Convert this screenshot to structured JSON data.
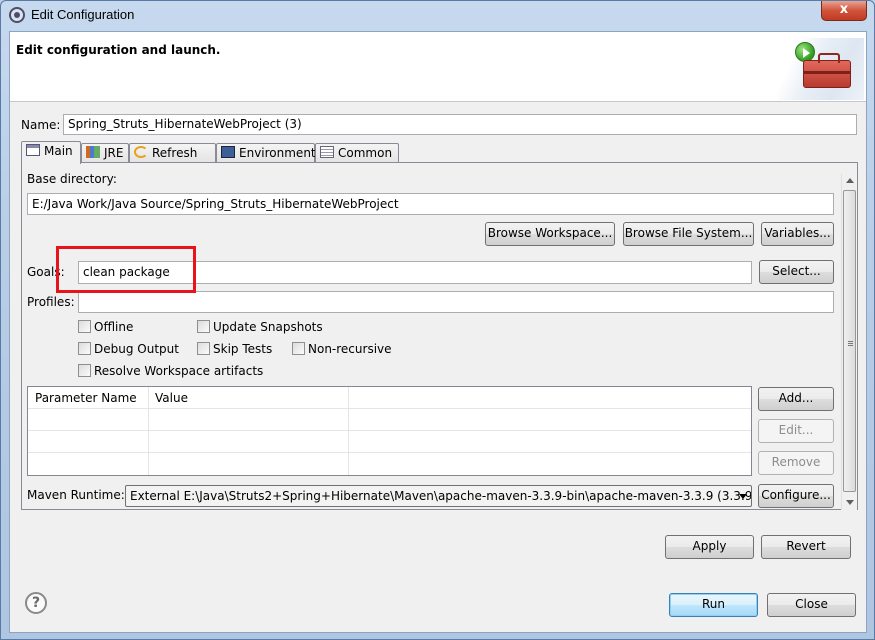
{
  "window": {
    "title": "Edit Configuration",
    "close_glyph": "x"
  },
  "header": {
    "title": "Edit configuration and launch."
  },
  "name": {
    "label": "Name:",
    "value": "Spring_Struts_HibernateWebProject (3)"
  },
  "tabs": [
    {
      "label": "Main",
      "icon": "main-tab-icon",
      "active": true
    },
    {
      "label": "JRE",
      "icon": "jre-icon"
    },
    {
      "label": "Refresh",
      "icon": "refresh-icon"
    },
    {
      "label": "Environment",
      "icon": "environment-icon"
    },
    {
      "label": "Common",
      "icon": "common-icon"
    }
  ],
  "main": {
    "base_directory": {
      "label": "Base directory:",
      "value": "E:/Java Work/Java Source/Spring_Struts_HibernateWebProject"
    },
    "buttons": {
      "browse_workspace": "Browse Workspace...",
      "browse_file_system": "Browse File System...",
      "variables": "Variables...",
      "select": "Select...",
      "add": "Add...",
      "edit": "Edit...",
      "remove": "Remove",
      "configure": "Configure..."
    },
    "goals": {
      "label": "Goals:",
      "value": "clean package"
    },
    "profiles": {
      "label": "Profiles:",
      "value": ""
    },
    "checkboxes": {
      "offline": "Offline",
      "update_snapshots": "Update Snapshots",
      "debug_output": "Debug Output",
      "skip_tests": "Skip Tests",
      "non_recursive": "Non-recursive",
      "resolve_workspace": "Resolve Workspace artifacts"
    },
    "parameter_table": {
      "columns": [
        "Parameter Name",
        "Value"
      ],
      "rows": []
    },
    "maven_runtime": {
      "label": "Maven Runtime:",
      "value": "External E:\\Java\\Struts2+Spring+Hibernate\\Maven\\apache-maven-3.3.9-bin\\apache-maven-3.3.9 (3.3.9)"
    }
  },
  "footer": {
    "apply": "Apply",
    "revert": "Revert",
    "run": "Run",
    "close": "Close",
    "help_glyph": "?"
  },
  "colors": {
    "highlight": "#e8141c",
    "dialog_bg": "#f0f0f0",
    "default_button": "#bee6fd"
  }
}
